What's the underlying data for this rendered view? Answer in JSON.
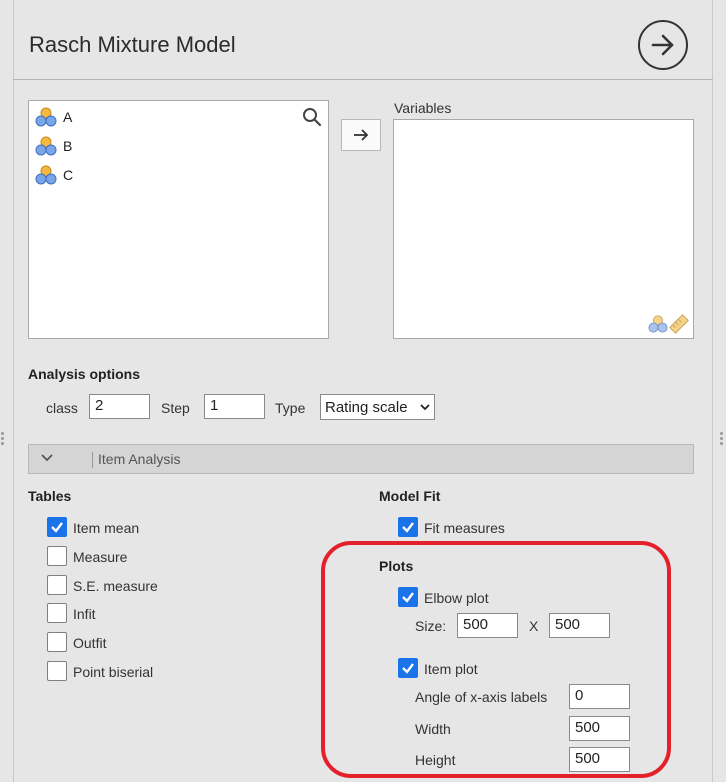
{
  "header": {
    "title": "Rasch Mixture Model",
    "run_icon": "arrow-circle-right-icon"
  },
  "source_list": {
    "items": [
      {
        "name": "A",
        "icon": "nominal-variable-icon"
      },
      {
        "name": "B",
        "icon": "nominal-variable-icon"
      },
      {
        "name": "C",
        "icon": "nominal-variable-icon"
      }
    ],
    "search_icon": "search-icon"
  },
  "transfer": {
    "icon": "arrow-right-icon"
  },
  "variables": {
    "label": "Variables",
    "items": []
  },
  "analysis_options": {
    "heading": "Analysis options",
    "class_label": "class",
    "class_value": "2",
    "step_label": "Step",
    "step_value": "1",
    "type_label": "Type",
    "type_value": "Rating scale"
  },
  "item_analysis": {
    "label": "Item Analysis",
    "expanded": true
  },
  "tables": {
    "heading": "Tables",
    "items": [
      {
        "label": "Item mean",
        "checked": true
      },
      {
        "label": "Measure",
        "checked": false
      },
      {
        "label": "S.E. measure",
        "checked": false
      },
      {
        "label": "Infit",
        "checked": false
      },
      {
        "label": "Outfit",
        "checked": false
      },
      {
        "label": "Point biserial",
        "checked": false
      }
    ]
  },
  "model_fit": {
    "heading": "Model Fit",
    "fit_measures_label": "Fit measures",
    "fit_measures_checked": true
  },
  "plots": {
    "heading": "Plots",
    "elbow_label": "Elbow plot",
    "elbow_checked": true,
    "size_label": "Size:",
    "size_w": "500",
    "size_x": "X",
    "size_h": "500",
    "item_label": "Item plot",
    "item_checked": true,
    "angle_label": "Angle of x-axis labels",
    "angle_value": "0",
    "width_label": "Width",
    "width_value": "500",
    "height_label": "Height",
    "height_value": "500"
  },
  "colors": {
    "accent": "#1a73e8",
    "highlight": "#e4202b",
    "background": "#e6e6e6"
  }
}
